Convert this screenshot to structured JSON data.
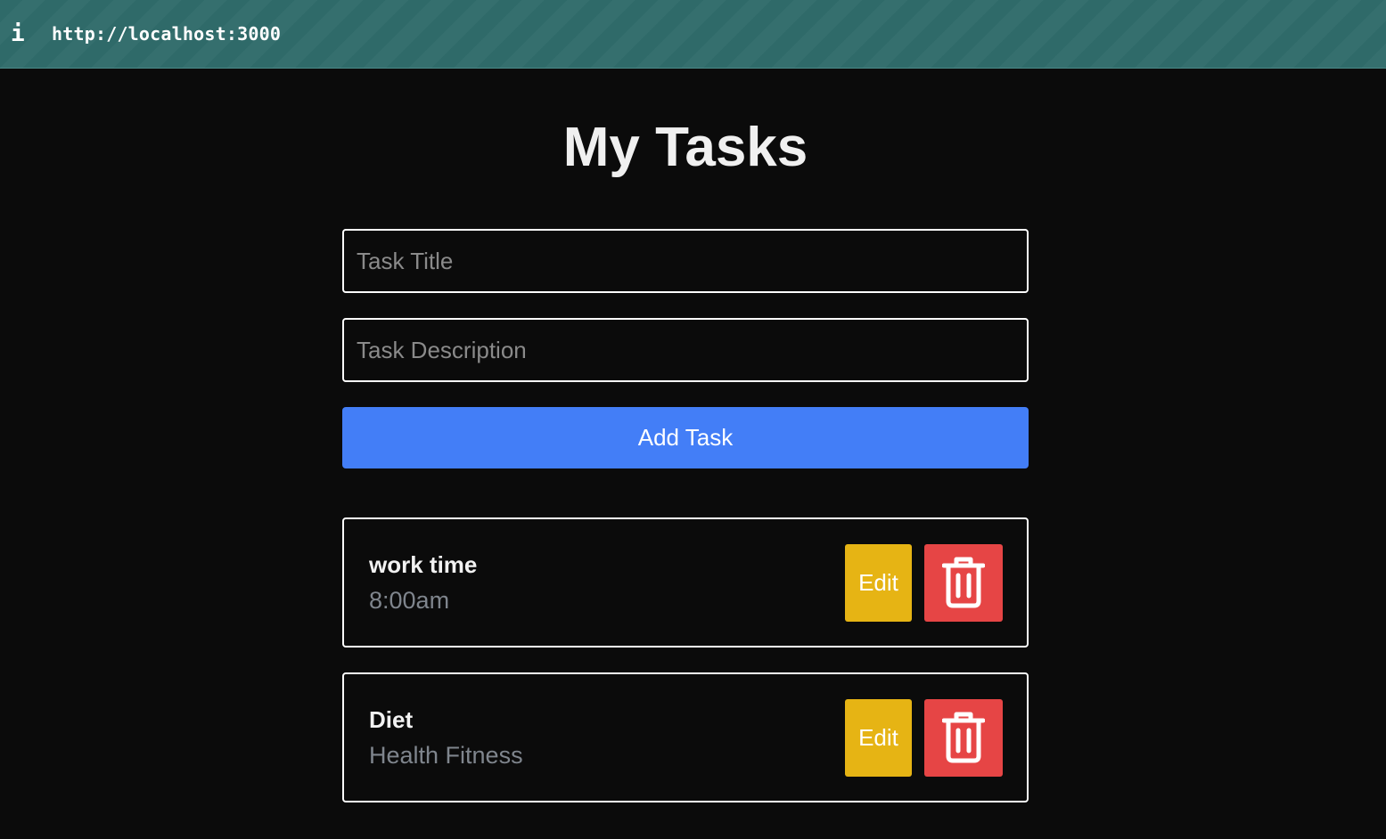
{
  "browser": {
    "url": "http://localhost:3000",
    "info_icon": "i"
  },
  "page": {
    "title": "My Tasks"
  },
  "form": {
    "title_placeholder": "Task Title",
    "description_placeholder": "Task Description",
    "add_label": "Add Task"
  },
  "tasks": [
    {
      "title": "work time",
      "description": "8:00am",
      "edit_label": "Edit",
      "delete_icon": "trash-icon"
    },
    {
      "title": "Diet",
      "description": "Health Fitness",
      "edit_label": "Edit",
      "delete_icon": "trash-icon"
    }
  ],
  "colors": {
    "primary": "#437ef7",
    "edit": "#e6b414",
    "delete": "#e64545",
    "background": "#0b0b0b",
    "topbar": "#2f6a69"
  }
}
